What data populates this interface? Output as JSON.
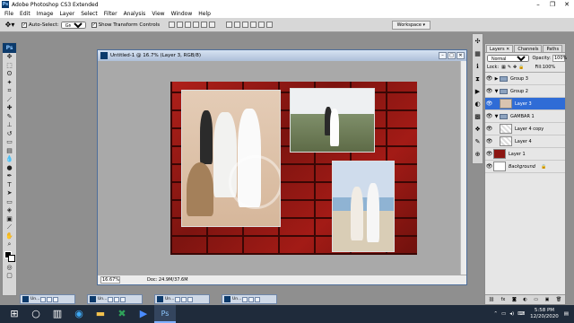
{
  "app": {
    "title": "Adobe Photoshop CS3 Extended"
  },
  "window_controls": {
    "minimize": "–",
    "restore": "❐",
    "close": "✕"
  },
  "menu": [
    "File",
    "Edit",
    "Image",
    "Layer",
    "Select",
    "Filter",
    "Analysis",
    "View",
    "Window",
    "Help"
  ],
  "options": {
    "tool_icon": "move-tool-icon",
    "auto_select_label": "Auto-Select:",
    "auto_select_value": "Group",
    "show_transform_label": "Show Transform Controls",
    "workspace_label": "Workspace ▾"
  },
  "document": {
    "title": "Untitled-1 @ 16.7% (Layer 3, RGB/8)",
    "zoom": "16.67%",
    "doc_size": "Doc: 24.9M/37.6M"
  },
  "layers_panel": {
    "tabs": [
      "Layers ✕",
      "Channels",
      "Paths"
    ],
    "blend_mode": "Normal",
    "opacity_label": "Opacity:",
    "opacity": "100%",
    "lock_label": "Lock:",
    "fill_label": "Fill:",
    "fill": "100%",
    "layers": [
      {
        "name": "Group 3",
        "type": "group",
        "selected": false
      },
      {
        "name": "Group 2",
        "type": "group",
        "selected": false
      },
      {
        "name": "Layer 3",
        "type": "layer",
        "selected": true
      },
      {
        "name": "GAMBAR 1",
        "type": "group",
        "selected": false
      },
      {
        "name": "Layer 4 copy",
        "type": "layer",
        "selected": false
      },
      {
        "name": "Layer 4",
        "type": "layer",
        "selected": false
      },
      {
        "name": "Layer 1",
        "type": "layer",
        "selected": false
      },
      {
        "name": "Background",
        "type": "layer",
        "selected": false
      }
    ]
  },
  "minimized_docs": [
    "Un...",
    "Un...",
    "Un...",
    "Un..."
  ],
  "taskbar": {
    "time": "5:58 PM",
    "date": "12/20/2020"
  },
  "colors": {
    "selection": "#2f6cd6",
    "brick": "#a31b16",
    "ps_blue": "#0c3a6b"
  }
}
